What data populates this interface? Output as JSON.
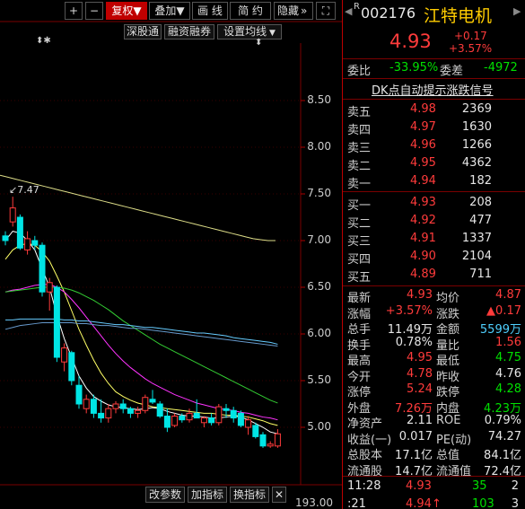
{
  "toolbar": {
    "plus": "+",
    "minus": "−",
    "restore_rights": "复权",
    "overlay": "叠加",
    "draw_line": "画 线",
    "short_term": "简 约",
    "hide": "隐藏",
    "more": "»",
    "fullscreen": "⛶"
  },
  "subtoolbar": {
    "markers": "⬍✱",
    "shenzhen_connect": "深股通",
    "margin_trading": "融资融券",
    "ma_settings": "设置均线"
  },
  "chart_header_marker": "⬍",
  "price_axis": [
    "8.50",
    "8.00",
    "7.50",
    "7.00",
    "6.50",
    "6.00",
    "5.50",
    "5.00"
  ],
  "high_annotation": "7.47",
  "bottom": {
    "change_params": "改参数",
    "add_indicator": "加指标",
    "switch_indicator": "换指标",
    "close": "✕",
    "volume_axis": "193.00"
  },
  "chart_data": {
    "type": "candlestick",
    "ylim": [
      4.7,
      8.7
    ],
    "candles": [
      {
        "o": 7.05,
        "h": 7.1,
        "l": 6.95,
        "c": 7.0
      },
      {
        "o": 7.2,
        "h": 7.47,
        "l": 7.15,
        "c": 7.35
      },
      {
        "o": 7.25,
        "h": 7.28,
        "l": 6.9,
        "c": 6.92
      },
      {
        "o": 6.9,
        "h": 7.1,
        "l": 6.85,
        "c": 7.02
      },
      {
        "o": 7.0,
        "h": 7.05,
        "l": 6.9,
        "c": 6.95
      },
      {
        "o": 6.95,
        "h": 6.98,
        "l": 6.4,
        "c": 6.45
      },
      {
        "o": 6.45,
        "h": 6.6,
        "l": 6.25,
        "c": 6.55
      },
      {
        "o": 6.5,
        "h": 6.52,
        "l": 5.7,
        "c": 5.75
      },
      {
        "o": 5.7,
        "h": 5.9,
        "l": 5.6,
        "c": 5.85
      },
      {
        "o": 5.8,
        "h": 5.82,
        "l": 5.45,
        "c": 5.5
      },
      {
        "o": 5.45,
        "h": 5.55,
        "l": 5.2,
        "c": 5.25
      },
      {
        "o": 5.2,
        "h": 5.35,
        "l": 5.15,
        "c": 5.3
      },
      {
        "o": 5.3,
        "h": 5.35,
        "l": 5.1,
        "c": 5.15
      },
      {
        "o": 5.15,
        "h": 5.3,
        "l": 5.05,
        "c": 5.1
      },
      {
        "o": 5.1,
        "h": 5.25,
        "l": 5.05,
        "c": 5.2
      },
      {
        "o": 5.2,
        "h": 5.28,
        "l": 5.15,
        "c": 5.25
      },
      {
        "o": 5.25,
        "h": 5.3,
        "l": 5.15,
        "c": 5.2
      },
      {
        "o": 5.2,
        "h": 5.22,
        "l": 5.1,
        "c": 5.15
      },
      {
        "o": 5.15,
        "h": 5.22,
        "l": 5.1,
        "c": 5.18
      },
      {
        "o": 5.18,
        "h": 5.35,
        "l": 5.15,
        "c": 5.32
      },
      {
        "o": 5.3,
        "h": 5.4,
        "l": 5.25,
        "c": 5.27
      },
      {
        "o": 5.25,
        "h": 5.28,
        "l": 5.1,
        "c": 5.12
      },
      {
        "o": 5.12,
        "h": 5.2,
        "l": 4.95,
        "c": 5.0
      },
      {
        "o": 5.02,
        "h": 5.15,
        "l": 5.0,
        "c": 5.12
      },
      {
        "o": 5.12,
        "h": 5.15,
        "l": 5.05,
        "c": 5.08
      },
      {
        "o": 5.08,
        "h": 5.2,
        "l": 5.05,
        "c": 5.15
      },
      {
        "o": 5.15,
        "h": 5.3,
        "l": 5.1,
        "c": 5.1
      },
      {
        "o": 5.05,
        "h": 5.12,
        "l": 5.0,
        "c": 5.1
      },
      {
        "o": 5.1,
        "h": 5.15,
        "l": 5.02,
        "c": 5.05
      },
      {
        "o": 5.05,
        "h": 5.25,
        "l": 5.02,
        "c": 5.22
      },
      {
        "o": 5.2,
        "h": 5.25,
        "l": 5.1,
        "c": 5.18
      },
      {
        "o": 5.18,
        "h": 5.22,
        "l": 5.05,
        "c": 5.1
      },
      {
        "o": 5.15,
        "h": 5.18,
        "l": 5.0,
        "c": 5.02
      },
      {
        "o": 5.0,
        "h": 5.12,
        "l": 4.92,
        "c": 5.08
      },
      {
        "o": 5.02,
        "h": 5.05,
        "l": 4.88,
        "c": 4.9
      },
      {
        "o": 4.92,
        "h": 4.95,
        "l": 4.78,
        "c": 4.8
      },
      {
        "o": 4.8,
        "h": 4.85,
        "l": 4.78,
        "c": 4.82
      },
      {
        "o": 4.8,
        "h": 4.98,
        "l": 4.78,
        "c": 4.93
      }
    ],
    "ma_lines": [
      {
        "color": "#ffffff",
        "values": [
          7.0,
          7.1,
          7.08,
          7.0,
          6.9,
          6.7,
          6.5,
          6.2,
          5.95,
          5.75,
          5.55,
          5.42,
          5.33,
          5.28,
          5.24,
          5.22,
          5.21,
          5.2,
          5.19,
          5.2,
          5.21,
          5.2,
          5.17,
          5.15,
          5.13,
          5.12,
          5.12,
          5.11,
          5.1,
          5.1,
          5.11,
          5.12,
          5.11,
          5.08,
          5.04,
          5.0,
          4.95,
          4.93
        ]
      },
      {
        "color": "#ffff66",
        "values": [
          6.8,
          6.9,
          6.95,
          6.97,
          6.95,
          6.88,
          6.78,
          6.62,
          6.45,
          6.25,
          6.05,
          5.88,
          5.72,
          5.58,
          5.47,
          5.38,
          5.33,
          5.29,
          5.26,
          5.24,
          5.22,
          5.21,
          5.2,
          5.19,
          5.18,
          5.17,
          5.16,
          5.15,
          5.15,
          5.14,
          5.13,
          5.13,
          5.12,
          5.11,
          5.09,
          5.07,
          5.04,
          5.02
        ]
      },
      {
        "color": "#ff33ff",
        "values": [
          6.45,
          6.47,
          6.48,
          6.5,
          6.52,
          6.53,
          6.53,
          6.5,
          6.45,
          6.37,
          6.28,
          6.18,
          6.08,
          5.98,
          5.88,
          5.79,
          5.71,
          5.64,
          5.58,
          5.52,
          5.47,
          5.43,
          5.39,
          5.35,
          5.32,
          5.29,
          5.26,
          5.24,
          5.22,
          5.2,
          5.19,
          5.18,
          5.16,
          5.15,
          5.13,
          5.11,
          5.1,
          5.08
        ]
      },
      {
        "color": "#33cc33",
        "values": [
          6.45,
          6.46,
          6.47,
          6.48,
          6.49,
          6.5,
          6.5,
          6.5,
          6.49,
          6.47,
          6.44,
          6.4,
          6.36,
          6.31,
          6.26,
          6.2,
          6.14,
          6.09,
          6.04,
          5.99,
          5.94,
          5.89,
          5.85,
          5.81,
          5.77,
          5.73,
          5.69,
          5.65,
          5.61,
          5.57,
          5.53,
          5.49,
          5.45,
          5.41,
          5.37,
          5.33,
          5.29,
          5.26
        ]
      },
      {
        "color": "#66ccff",
        "values": [
          6.15,
          6.15,
          6.16,
          6.16,
          6.16,
          6.16,
          6.16,
          6.16,
          6.15,
          6.15,
          6.14,
          6.14,
          6.13,
          6.12,
          6.11,
          6.1,
          6.1,
          6.09,
          6.08,
          6.07,
          6.07,
          6.06,
          6.05,
          6.04,
          6.03,
          6.02,
          6.01,
          6.01,
          6.0,
          5.99,
          5.98,
          5.96,
          5.95,
          5.94,
          5.93,
          5.92,
          5.91,
          5.89
        ]
      },
      {
        "color": "#6699cc",
        "values": [
          6.05,
          6.07,
          6.09,
          6.1,
          6.11,
          6.12,
          6.12,
          6.12,
          6.12,
          6.12,
          6.11,
          6.11,
          6.1,
          6.09,
          6.09,
          6.08,
          6.07,
          6.06,
          6.06,
          6.05,
          6.04,
          6.03,
          6.02,
          6.01,
          6.0,
          5.99,
          5.98,
          5.97,
          5.96,
          5.95,
          5.94,
          5.93,
          5.92,
          5.91,
          5.9,
          5.89,
          5.88,
          5.87
        ]
      },
      {
        "color": "#dddd88",
        "values": [
          7.7,
          7.68,
          7.66,
          7.64,
          7.62,
          7.6,
          7.58,
          7.56,
          7.54,
          7.52,
          7.5,
          7.48,
          7.46,
          7.44,
          7.42,
          7.4,
          7.38,
          7.36,
          7.34,
          7.32,
          7.3,
          7.28,
          7.26,
          7.24,
          7.22,
          7.2,
          7.18,
          7.16,
          7.14,
          7.12,
          7.1,
          7.08,
          7.06,
          7.04,
          7.02,
          7.01,
          7.0,
          7.0
        ]
      }
    ]
  },
  "quote": {
    "r_badge": "R",
    "code": "002176",
    "name": "江特电机",
    "price": "4.93",
    "change": "+0.17",
    "change_pct": "+3.57%",
    "wei_bi_label": "委比",
    "wei_bi": "-33.95%",
    "wei_cha_label": "委差",
    "wei_cha": "-4972",
    "signal": "DK点自动提示涨跌信号",
    "asks": [
      {
        "label": "卖五",
        "price": "4.98",
        "vol": "2369"
      },
      {
        "label": "卖四",
        "price": "4.97",
        "vol": "1630"
      },
      {
        "label": "卖三",
        "price": "4.96",
        "vol": "1266"
      },
      {
        "label": "卖二",
        "price": "4.95",
        "vol": "4362"
      },
      {
        "label": "卖一",
        "price": "4.94",
        "vol": "182"
      }
    ],
    "bids": [
      {
        "label": "买一",
        "price": "4.93",
        "vol": "208"
      },
      {
        "label": "买二",
        "price": "4.92",
        "vol": "477"
      },
      {
        "label": "买三",
        "price": "4.91",
        "vol": "1337"
      },
      {
        "label": "买四",
        "price": "4.90",
        "vol": "2104"
      },
      {
        "label": "买五",
        "price": "4.89",
        "vol": "711"
      }
    ],
    "stats": [
      {
        "l1": "最新",
        "v1": "4.93",
        "c1": "red",
        "l2": "均价",
        "v2": "4.87",
        "c2": "red"
      },
      {
        "l1": "涨幅",
        "v1": "+3.57%",
        "c1": "red",
        "l2": "涨跌",
        "v2": "▲0.17",
        "c2": "red"
      },
      {
        "l1": "总手",
        "v1": "11.49万",
        "c1": "white",
        "l2": "金额",
        "v2": "5599万",
        "c2": "cyan"
      },
      {
        "l1": "换手",
        "v1": "0.78%",
        "c1": "white",
        "l2": "量比",
        "v2": "1.56",
        "c2": "red"
      },
      {
        "l1": "最高",
        "v1": "4.95",
        "c1": "red",
        "l2": "最低",
        "v2": "4.75",
        "c2": "green"
      },
      {
        "l1": "今开",
        "v1": "4.78",
        "c1": "red",
        "l2": "昨收",
        "v2": "4.76",
        "c2": "white"
      },
      {
        "l1": "涨停",
        "v1": "5.24",
        "c1": "red",
        "l2": "跌停",
        "v2": "4.28",
        "c2": "green"
      },
      {
        "l1": "外盘",
        "v1": "7.26万",
        "c1": "red",
        "l2": "内盘",
        "v2": "4.23万",
        "c2": "green"
      },
      {
        "l1": "净资产",
        "v1": "2.11",
        "c1": "white",
        "l2": "ROE",
        "v2": "0.79%",
        "c2": "white"
      },
      {
        "l1": "收益(一)",
        "v1": "0.017",
        "c1": "white",
        "l2": "PE(动)",
        "v2": "74.27",
        "c2": "white"
      },
      {
        "l1": "总股本",
        "v1": "17.1亿",
        "c1": "white",
        "l2": "总值",
        "v2": "84.1亿",
        "c2": "white"
      },
      {
        "l1": "流通股",
        "v1": "14.7亿",
        "c1": "white",
        "l2": "流通值",
        "v2": "72.4亿",
        "c2": "white"
      }
    ],
    "ticks": [
      {
        "time": "11:28",
        "price": "4.93",
        "vol": "35",
        "num": "2"
      },
      {
        "time": ":21",
        "price": "4.94↑",
        "vol": "103",
        "num": "3"
      }
    ]
  }
}
